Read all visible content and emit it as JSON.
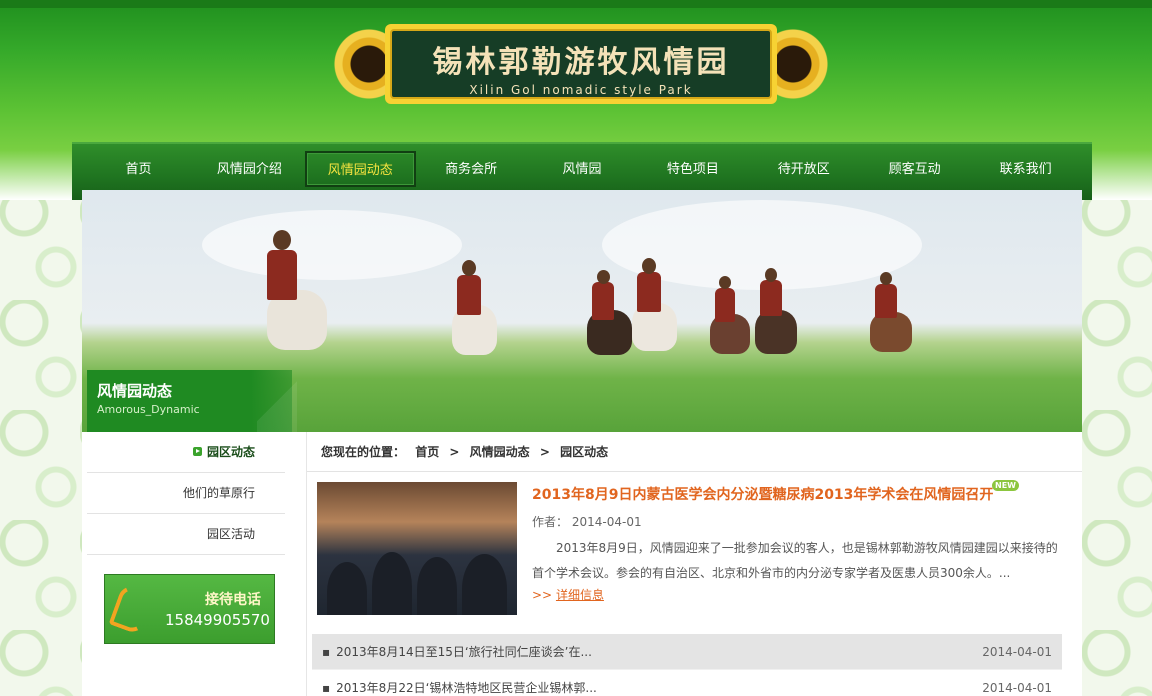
{
  "site": {
    "logo_cn": "锡林郭勒游牧风情园",
    "logo_en": "Xilin Gol nomadic style Park"
  },
  "nav": {
    "items": [
      {
        "label": "首页"
      },
      {
        "label": "风情园介绍"
      },
      {
        "label": "风情园动态"
      },
      {
        "label": "商务会所"
      },
      {
        "label": "风情园"
      },
      {
        "label": "特色项目"
      },
      {
        "label": "待开放区"
      },
      {
        "label": "顾客互动"
      },
      {
        "label": "联系我们"
      }
    ],
    "active_index": 2
  },
  "banner": {
    "title": "风情园动态",
    "subtitle": "Amorous_Dynamic"
  },
  "sidebar": {
    "items": [
      {
        "label": "园区动态"
      },
      {
        "label": "他们的草原行"
      },
      {
        "label": "园区活动"
      }
    ],
    "phone": {
      "title": "接待电话",
      "number": "15849905570"
    }
  },
  "breadcrumb": {
    "prefix": "您现在的位置：",
    "items": [
      "首页",
      "风情园动态",
      "园区动态"
    ],
    "separator": ">"
  },
  "featured": {
    "title": "2013年8月9日内蒙古医学会内分泌暨糖尿病2013年学术会在风情园召开",
    "badge": "NEW",
    "author_label": "作者：",
    "date": "2014-04-01",
    "summary": "2013年8月9日，风情园迎来了一批参加会议的客人，也是锡林郭勒游牧风情园建园以来接待的首个学术会议。参会的有自治区、北京和外省市的内分泌专家学者及医患人员300余人。...",
    "more_prefix": ">>",
    "more_label": "详细信息"
  },
  "news": [
    {
      "title": "2013年8月14日至15日‘旅行社同仁座谈会’在...",
      "date": "2014-04-01"
    },
    {
      "title": "2013年8月22日‘锡林浩特地区民营企业锡林郭...",
      "date": "2014-04-01"
    }
  ],
  "colors": {
    "brand_green": "#1f8a22",
    "accent_orange": "#e1651f",
    "nav_active": "#f6e440"
  }
}
